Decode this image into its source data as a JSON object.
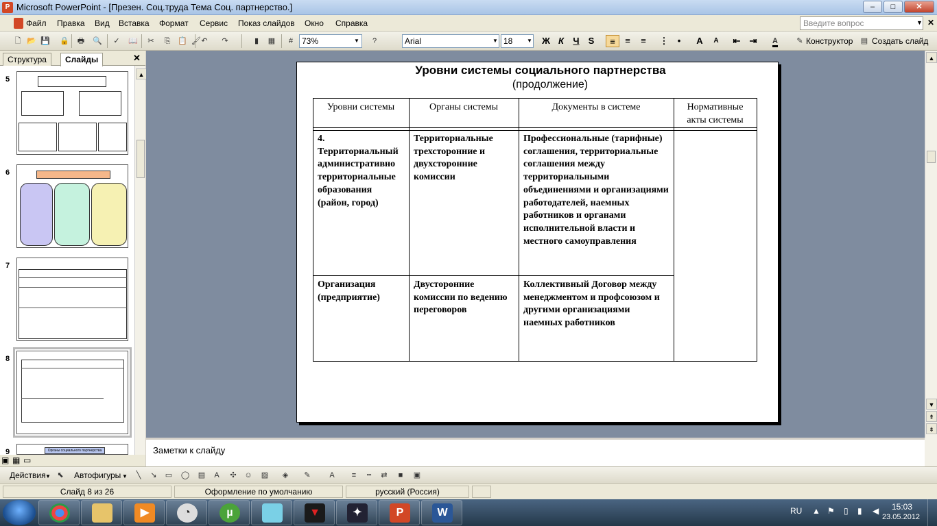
{
  "window": {
    "title": "Microsoft PowerPoint - [Презен. Соц.труда Тема Соц. партнерство.]",
    "minimize": "–",
    "maximize": "□",
    "close": "✕"
  },
  "menu": {
    "items": [
      "Файл",
      "Правка",
      "Вид",
      "Вставка",
      "Формат",
      "Сервис",
      "Показ слайдов",
      "Окно",
      "Справка"
    ],
    "help_placeholder": "Введите вопрос",
    "close_doc": "✕"
  },
  "toolbar": {
    "zoom": "73%",
    "font": "Arial",
    "font_size": "18",
    "bold": "Ж",
    "italic": "К",
    "underline": "Ч",
    "shadow": "S",
    "designer": "Конструктор",
    "new_slide": "Создать слайд"
  },
  "left_pane": {
    "tab_outline": "Структура",
    "tab_slides": "Слайды",
    "close": "✕",
    "slide_numbers": [
      "5",
      "6",
      "7",
      "8",
      "9"
    ],
    "thumb9_label": "Органы социального партнерства"
  },
  "slide": {
    "title": "Уровни системы социального партнерства",
    "subtitle": "(продолжение)",
    "headers": [
      "Уровни системы",
      "Органы системы",
      "Документы в системе",
      "Нормативные акты системы"
    ],
    "rows": [
      {
        "level": "4. Территориальный административно территориальные образования (район, город)",
        "organs": "Территориальные трехсторонние и двухсторонние комиссии",
        "docs": "Профессиональные (тарифные) соглашения, территориальные соглашения между территориальными объединениями и организациями работодателей, наемных работников и органами исполнительной власти и местного самоуправления",
        "acts": ""
      },
      {
        "level": "Организация (предприятие)",
        "organs": "Двусторонние комиссии по ведению переговоров",
        "docs": "Коллективный Договор между менеджментом и профсоюзом и другими организациями наемных работников",
        "acts": ""
      }
    ]
  },
  "notes": {
    "placeholder": "Заметки к слайду"
  },
  "drawing": {
    "actions": "Действия",
    "autoshapes": "Автофигуры"
  },
  "status": {
    "slide": "Слайд 8 из 26",
    "design": "Оформление по умолчанию",
    "language": "русский (Россия)"
  },
  "tray": {
    "lang": "RU",
    "time": "15:03",
    "date": "23.05.2012"
  }
}
